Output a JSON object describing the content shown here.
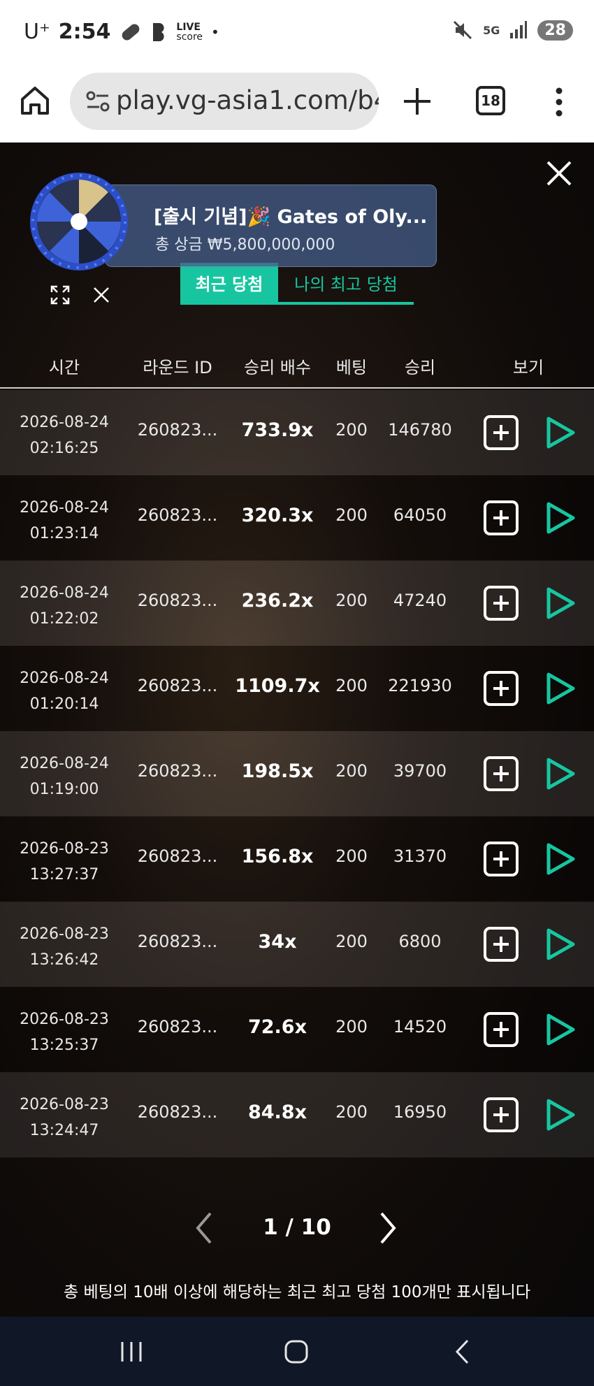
{
  "status_bar": {
    "carrier": "U⁺",
    "time": "2:54",
    "livescore_line1": "LIVE",
    "livescore_line2": "score",
    "dot": "•",
    "network": "5G",
    "battery": "28"
  },
  "browser": {
    "url": "play.vg-asia1.com/b4(",
    "tab_count": "18"
  },
  "promo": {
    "title": "[출시 기념]🎉 Gates of Oly...",
    "subtitle": "총 상금 ₩5,800,000,000"
  },
  "tabs": {
    "recent": "최근 당첨",
    "best": "나의 최고 당첨"
  },
  "columns": {
    "time": "시간",
    "round_id": "라운드 ID",
    "multiplier": "승리 배수",
    "bet": "베팅",
    "win": "승리",
    "view": "보기"
  },
  "rows": [
    {
      "date": "2026-08-24",
      "time": "02:16:25",
      "round": "260823...",
      "mult": "733.9x",
      "bet": "200",
      "win": "146780"
    },
    {
      "date": "2026-08-24",
      "time": "01:23:14",
      "round": "260823...",
      "mult": "320.3x",
      "bet": "200",
      "win": "64050"
    },
    {
      "date": "2026-08-24",
      "time": "01:22:02",
      "round": "260823...",
      "mult": "236.2x",
      "bet": "200",
      "win": "47240"
    },
    {
      "date": "2026-08-24",
      "time": "01:20:14",
      "round": "260823...",
      "mult": "1109.7x",
      "bet": "200",
      "win": "221930"
    },
    {
      "date": "2026-08-24",
      "time": "01:19:00",
      "round": "260823...",
      "mult": "198.5x",
      "bet": "200",
      "win": "39700"
    },
    {
      "date": "2026-08-23",
      "time": "13:27:37",
      "round": "260823...",
      "mult": "156.8x",
      "bet": "200",
      "win": "31370"
    },
    {
      "date": "2026-08-23",
      "time": "13:26:42",
      "round": "260823...",
      "mult": "34x",
      "bet": "200",
      "win": "6800"
    },
    {
      "date": "2026-08-23",
      "time": "13:25:37",
      "round": "260823...",
      "mult": "72.6x",
      "bet": "200",
      "win": "14520"
    },
    {
      "date": "2026-08-23",
      "time": "13:24:47",
      "round": "260823...",
      "mult": "84.8x",
      "bet": "200",
      "win": "16950"
    }
  ],
  "pagination": {
    "label": "1 / 10"
  },
  "footnote": "총 베팅의 10배 이상에 해당하는 최근 최고 당첨 100개만 표시됩니다",
  "colors": {
    "accent": "#17c6a0",
    "nav_bar": "#101828"
  }
}
